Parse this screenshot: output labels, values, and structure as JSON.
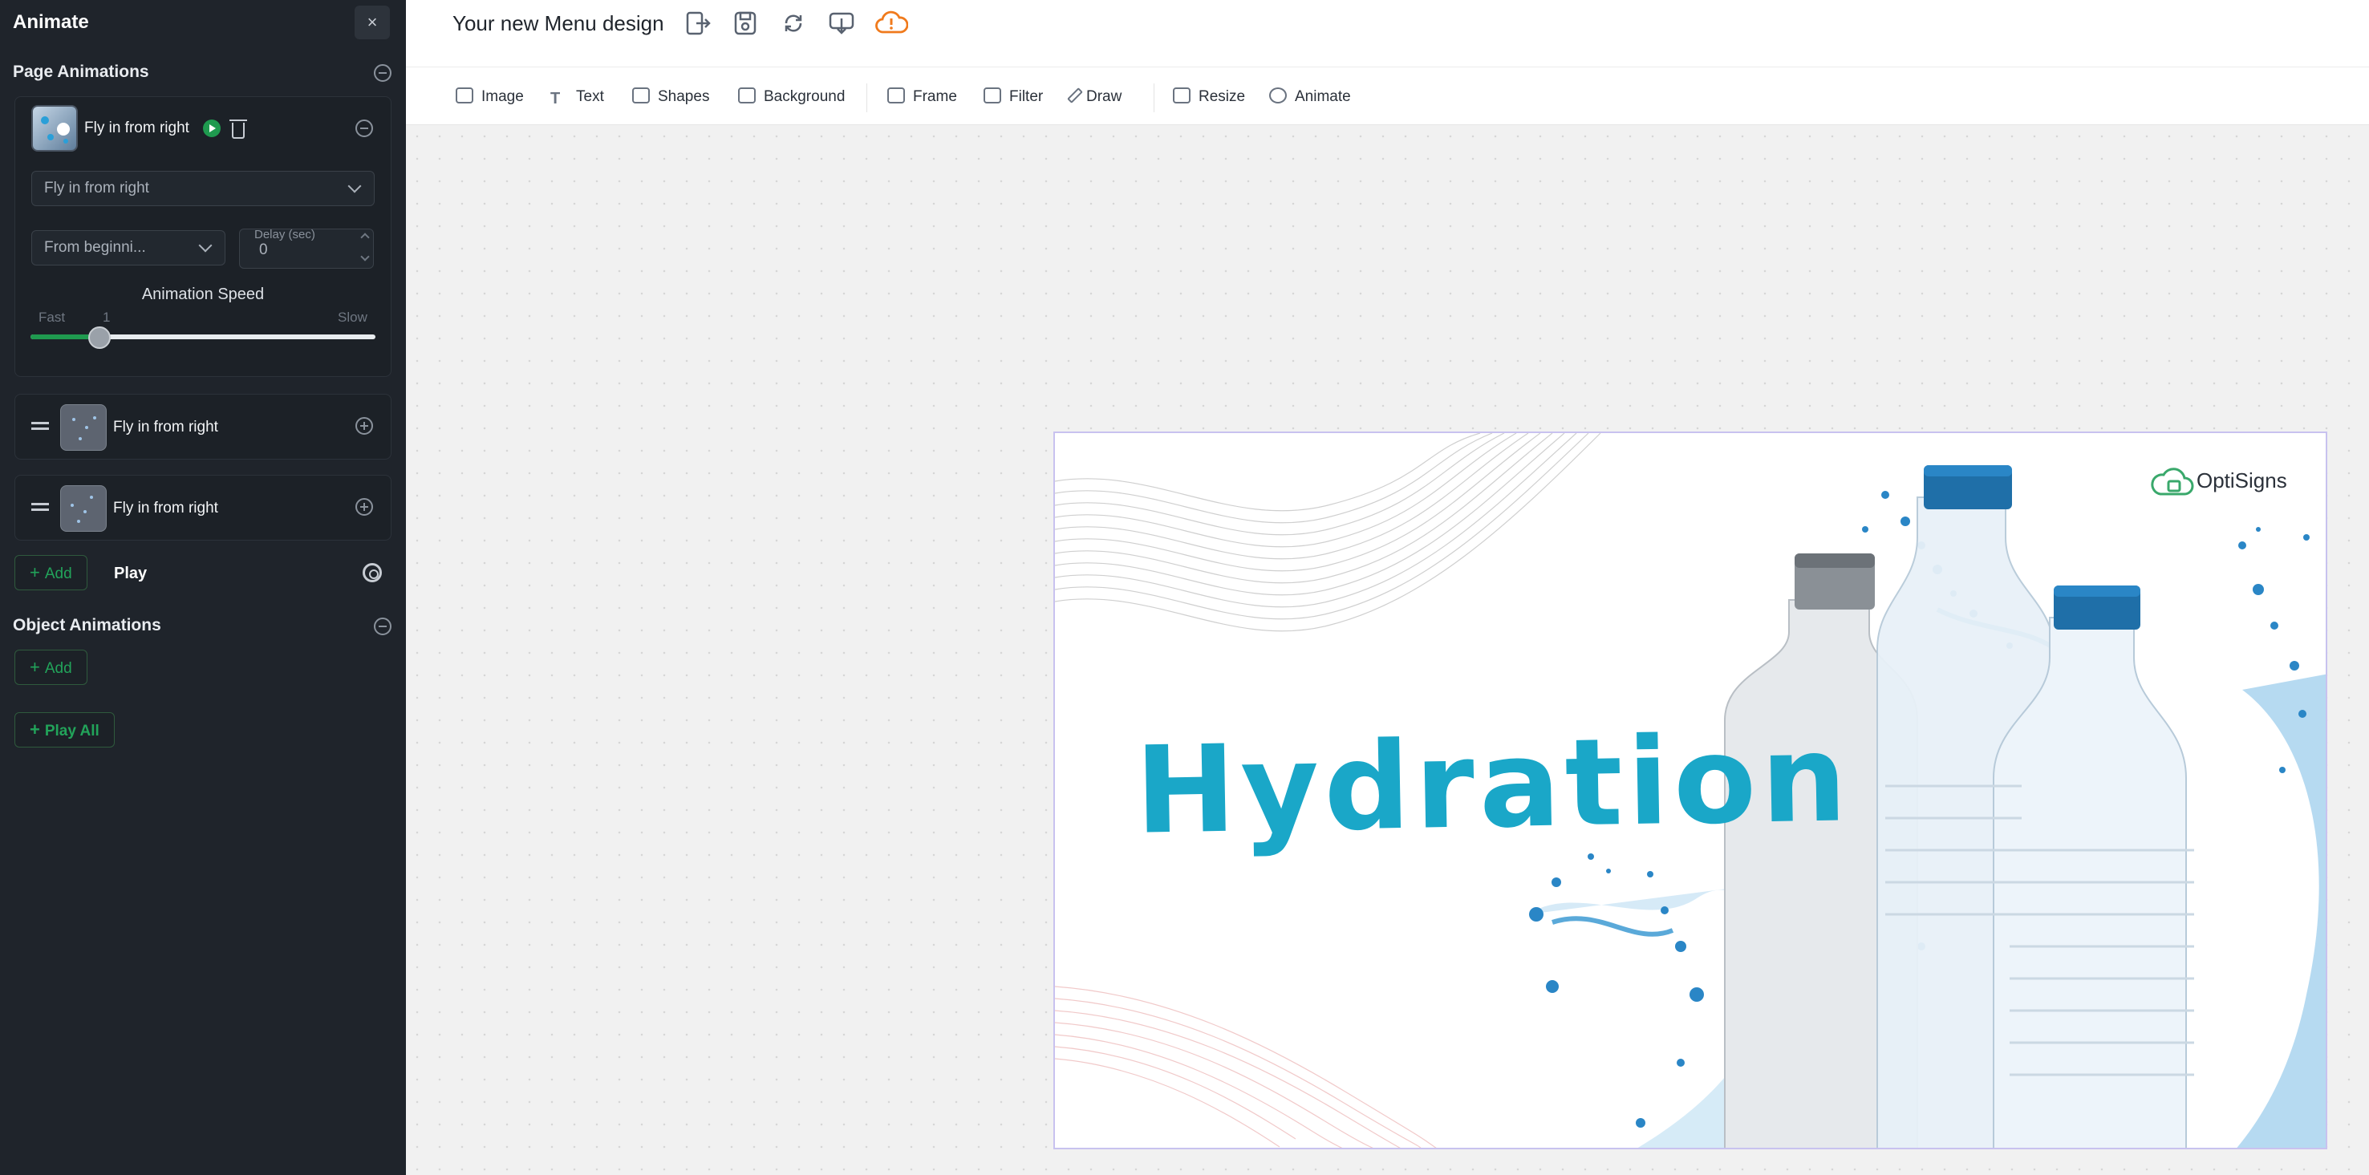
{
  "sidebar": {
    "title": "Animate",
    "close": "×",
    "page_animations": {
      "title": "Page Animations",
      "active": {
        "name": "Fly in from right",
        "effect": "Fly in from right",
        "start": "From beginni...",
        "delay_label": "Delay (sec)",
        "delay_value": "0",
        "speed_title": "Animation Speed",
        "speed_fast": "Fast",
        "speed_slow": "Slow",
        "speed_value": "1",
        "speed_fraction": 0.2
      },
      "items": [
        {
          "name": "Fly in from right"
        },
        {
          "name": "Fly in from right"
        }
      ],
      "add_label": "Add",
      "play_label": "Play"
    },
    "object_animations": {
      "title": "Object Animations",
      "add_label": "Add"
    },
    "play_all": "Play All",
    "collapse": "‹"
  },
  "header": {
    "title": "Your new Menu design"
  },
  "toolbar": {
    "items": [
      "Image",
      "Text",
      "Shapes",
      "Background",
      "Frame",
      "Filter",
      "Draw",
      "Resize",
      "Animate"
    ]
  },
  "design": {
    "headline": "Hydration",
    "brand": "OptiSigns"
  },
  "colors": {
    "accent_green": "#1f9a4f",
    "sidebar_bg": "#1f242b",
    "headline": "#1aa7c8",
    "warning_cloud": "#f07a1c"
  }
}
